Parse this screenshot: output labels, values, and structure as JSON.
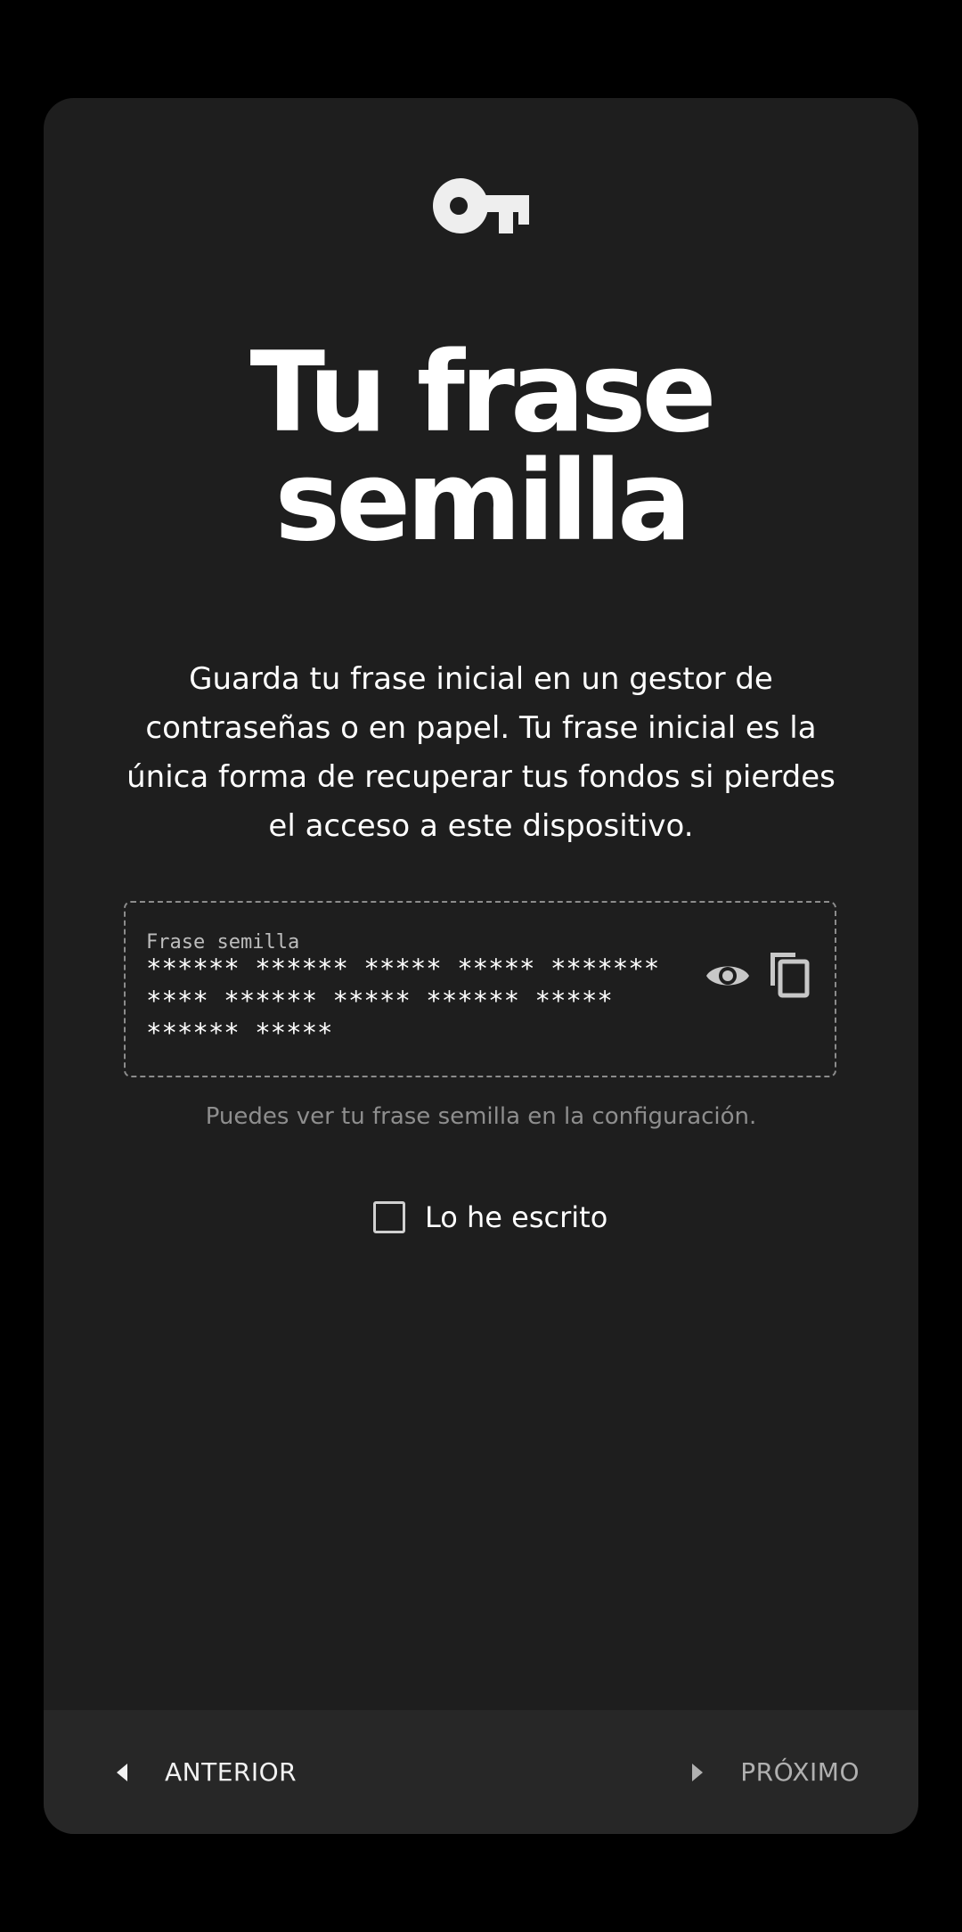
{
  "header": {
    "icon": "key-icon",
    "title_line1": "Tu frase",
    "title_line2": "semilla"
  },
  "description": {
    "line1": "Guarda tu frase inicial en un gestor de",
    "line2": "contraseñas o en papel. Tu frase inicial es la",
    "line3": "única forma de recuperar tus fondos si pierdes",
    "line4": "el acceso a este dispositivo."
  },
  "seed": {
    "label": "Frase semilla",
    "line1": "****** ****** ***** ***** *******",
    "line2": "**** ****** ***** ****** *****",
    "line3": "****** *****",
    "show_icon": "eye-icon",
    "copy_icon": "copy-icon"
  },
  "hint": "Puedes ver tu frase semilla en la configuración.",
  "confirm": {
    "label": "Lo he escrito",
    "checked": false
  },
  "footer": {
    "prev_label": "ANTERIOR",
    "next_label": "PRÓXIMO"
  },
  "colors": {
    "background": "#000000",
    "card": "#1e1e1e",
    "footer": "#272727",
    "text": "#ffffff",
    "muted": "#8e8e8e"
  }
}
